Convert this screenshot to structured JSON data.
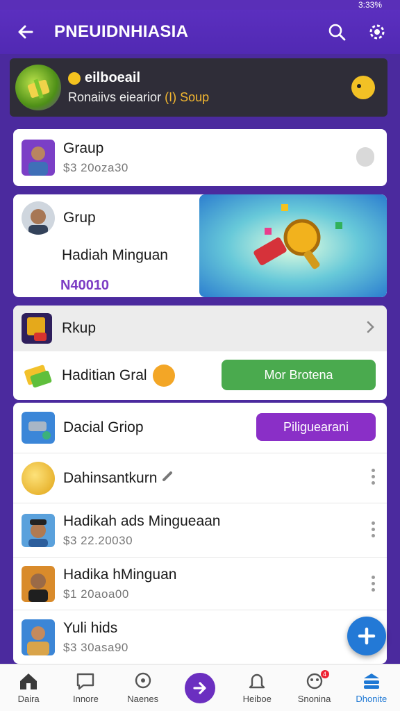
{
  "status": {
    "right_text": "3:33%"
  },
  "app_bar": {
    "title": "PNEUIDNHIASIA"
  },
  "banner": {
    "name": "eilboeail",
    "subtitle_prefix": "Ronaiivs eiearior",
    "subtitle_accent": "(I) Soup"
  },
  "card1": {
    "title": "Graup",
    "sub": "$3 20oza30"
  },
  "card2": {
    "title": "Grup",
    "line2": "Hadiah Minguan",
    "price": "N40010"
  },
  "card3": {
    "head_title": "Rkup",
    "body_title": "Haditian Gral",
    "button": "Mor Brotena"
  },
  "list": {
    "row1": {
      "title": "Dacial Griop",
      "button": "Piliguearani"
    },
    "row2": {
      "title": "Dahinsantkurn"
    },
    "row3": {
      "title": "Hadikah ads Mingueaan",
      "sub": "$3 22.20030"
    },
    "row4": {
      "title": "Hadika hMinguan",
      "sub": "$1 20aoa00"
    },
    "row5": {
      "title": "Yuli hids",
      "sub": "$3 30asa90"
    }
  },
  "bottom_nav": [
    {
      "label": "Daira",
      "icon": "home-icon"
    },
    {
      "label": "Innore",
      "icon": "chat-icon"
    },
    {
      "label": "Naenes",
      "icon": "message-icon"
    },
    {
      "label": "",
      "icon": "arrow-right-icon"
    },
    {
      "label": "Heiboe",
      "icon": "bell-icon"
    },
    {
      "label": "Snonina",
      "icon": "notification-icon",
      "badge": "4"
    },
    {
      "label": "Dhonite",
      "icon": "stack-icon"
    }
  ],
  "colors": {
    "primary": "#5b2fbf",
    "green": "#4aaa4e",
    "purple_btn": "#8a2fc7",
    "fab": "#2379d6"
  }
}
